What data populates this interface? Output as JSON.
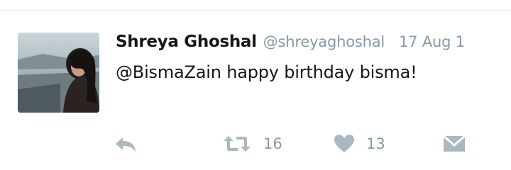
{
  "tweet": {
    "display_name": "Shreya Ghoshal",
    "handle": "@shreyaghoshal",
    "timestamp": "17 Aug 1",
    "mention": "@BismaZain",
    "text": " happy birthday bisma!"
  },
  "actions": {
    "reply_icon": "reply-icon",
    "retweet_icon": "retweet-icon",
    "retweet_count": "16",
    "like_icon": "heart-icon",
    "like_count": "13",
    "dm_icon": "envelope-icon"
  },
  "colors": {
    "text": "#14171a",
    "muted": "#8899a6",
    "icon": "#aab8c2"
  }
}
